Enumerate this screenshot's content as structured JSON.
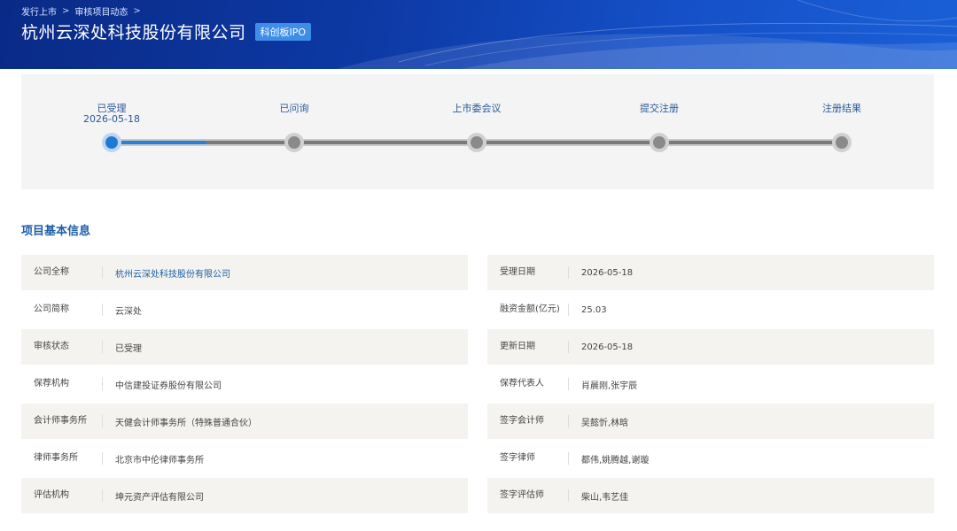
{
  "breadcrumb": [
    "发行上市",
    "审核项目动态"
  ],
  "header": {
    "title": "杭州云深处科技股份有限公司",
    "badge": "科创板IPO"
  },
  "progress": {
    "steps": [
      {
        "label": "已受理",
        "date": "2026-05-18",
        "status": "done"
      },
      {
        "label": "已问询",
        "date": "",
        "status": "pending"
      },
      {
        "label": "上市委会议",
        "date": "",
        "status": "pending"
      },
      {
        "label": "提交注册",
        "date": "",
        "status": "pending"
      },
      {
        "label": "注册结果",
        "date": "",
        "status": "pending"
      }
    ],
    "completed_fraction": 0.13
  },
  "section": {
    "title": "项目基本信息"
  },
  "info": {
    "left": [
      {
        "label": "公司全称",
        "value": "杭州云深处科技股份有限公司"
      },
      {
        "label": "公司简称",
        "value": "云深处"
      },
      {
        "label": "审核状态",
        "value": "已受理"
      },
      {
        "label": "保荐机构",
        "value": "中信建投证券股份有限公司"
      },
      {
        "label": "会计师事务所",
        "value": "天健会计师事务所（特殊普通合伙）"
      },
      {
        "label": "律师事务所",
        "value": "北京市中伦律师事务所"
      },
      {
        "label": "评估机构",
        "value": "坤元资产评估有限公司"
      }
    ],
    "right": [
      {
        "label": "受理日期",
        "value": "2026-05-18"
      },
      {
        "label": "融资金额(亿元)",
        "value": "25.03"
      },
      {
        "label": "更新日期",
        "value": "2026-05-18"
      },
      {
        "label": "保荐代表人",
        "value": "肖晨刚,张宇辰"
      },
      {
        "label": "签字会计师",
        "value": "吴懿忻,林晗"
      },
      {
        "label": "签字律师",
        "value": "都伟,姚腾越,谢璇"
      },
      {
        "label": "签字评估师",
        "value": "柴山,韦艺佳"
      }
    ]
  },
  "colors": {
    "banner": "#0d3aa6",
    "accent": "#1d5fa8",
    "active_node": "#1f7ad6",
    "badge": "#3e8ee9"
  }
}
